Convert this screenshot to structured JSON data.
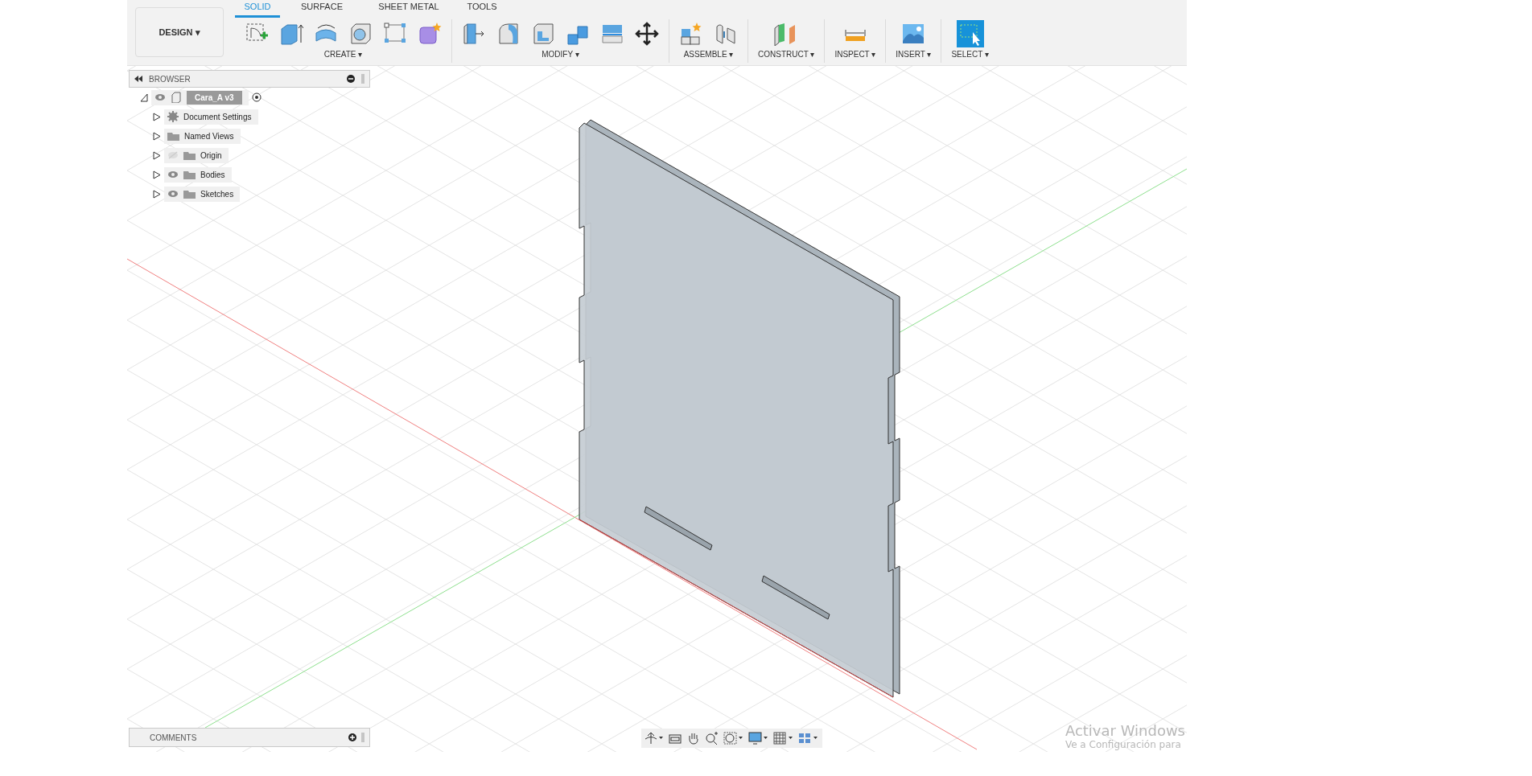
{
  "workspace_button": {
    "label": "DESIGN",
    "caret": "▾"
  },
  "tabs": [
    {
      "label": "SOLID",
      "selected": true
    },
    {
      "label": "SURFACE",
      "selected": false
    },
    {
      "label": "SHEET METAL",
      "selected": false
    },
    {
      "label": "TOOLS",
      "selected": false
    }
  ],
  "tool_groups": [
    {
      "kind": "create",
      "label": "CREATE ▾"
    },
    {
      "kind": "modify",
      "label": "MODIFY ▾"
    },
    {
      "kind": "assemble",
      "label": "ASSEMBLE ▾"
    },
    {
      "kind": "construct",
      "label": "CONSTRUCT ▾"
    },
    {
      "kind": "inspect",
      "label": "INSPECT ▾"
    },
    {
      "kind": "insert",
      "label": "INSERT ▾"
    },
    {
      "kind": "select",
      "label": "SELECT ▾"
    }
  ],
  "browser": {
    "title": "BROWSER",
    "root": {
      "label": "Cara_A v3",
      "expanded": true,
      "children": [
        {
          "label": "Document Settings",
          "kind": "settings",
          "expanded": false
        },
        {
          "label": "Named Views",
          "kind": "folder",
          "expanded": false
        },
        {
          "label": "Origin",
          "kind": "folder",
          "visible": false,
          "expanded": false
        },
        {
          "label": "Bodies",
          "kind": "folder",
          "visible": true,
          "expanded": false
        },
        {
          "label": "Sketches",
          "kind": "folder",
          "visible": true,
          "expanded": false
        }
      ]
    }
  },
  "comments": {
    "title": "COMMENTS"
  },
  "os_notice": {
    "title": "Activar Windows",
    "subtitle": "Ve a Configuración para"
  }
}
